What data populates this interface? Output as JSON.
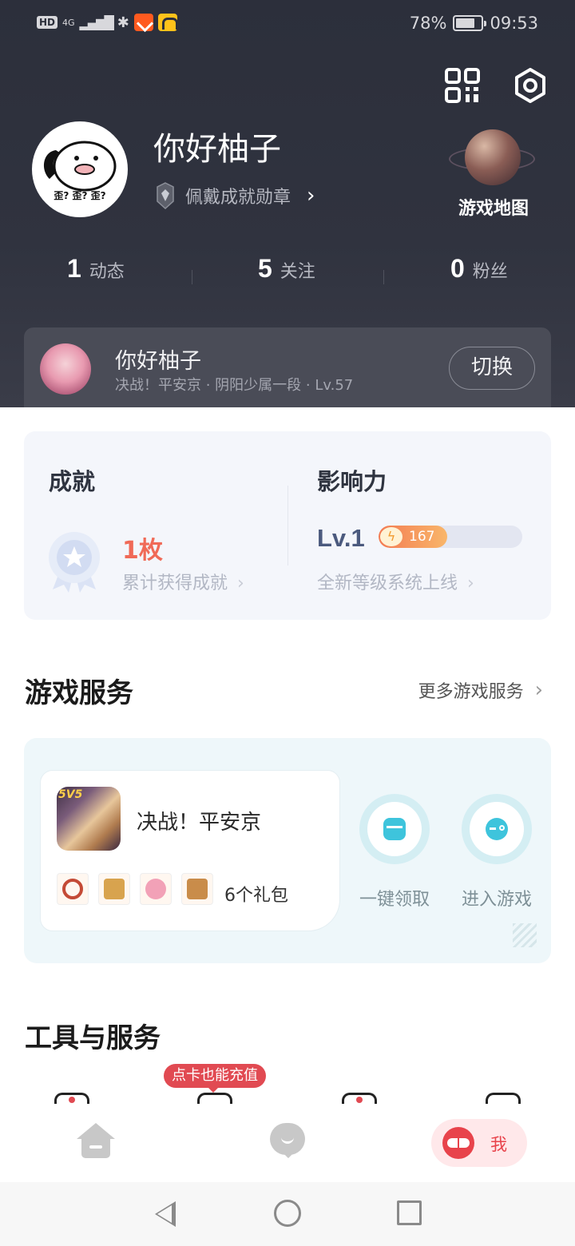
{
  "status_bar": {
    "hd": "HD",
    "network": "4G",
    "battery_text": "78%",
    "battery_level": 0.78,
    "time": "09:53"
  },
  "profile": {
    "username": "你好柚子",
    "avatar_caption": "歪? 歪? 歪?",
    "badge_text": "佩戴成就勋章",
    "map_label": "游戏地图",
    "stats": [
      {
        "num": "1",
        "label": "动态"
      },
      {
        "num": "5",
        "label": "关注"
      },
      {
        "num": "0",
        "label": "粉丝"
      }
    ]
  },
  "game_role": {
    "name": "你好柚子",
    "subtitle": "决战！平安京 · 阴阳少属一段 · Lv.57",
    "switch_label": "切换"
  },
  "achievement": {
    "title": "成就",
    "count": "1枚",
    "sub": "累计获得成就"
  },
  "influence": {
    "title": "影响力",
    "level": "Lv.1",
    "score": "167",
    "progress": 0.48,
    "sub": "全新等级系统上线"
  },
  "game_services": {
    "title": "游戏服务",
    "more": "更多游戏服务",
    "game_name": "决战！平安京",
    "game_icon_tag": "5V5",
    "gift_count": "6个礼包",
    "claim_label": "一键领取",
    "enter_label": "进入游戏"
  },
  "tools": {
    "title": "工具与服务",
    "recharge_tag": "点卡也能充值"
  },
  "bottom_nav": {
    "me_label": "我"
  },
  "colors": {
    "accent_red": "#e8434b",
    "achievement_orange": "#f06a57",
    "header_bg": "#2c2f3b"
  }
}
